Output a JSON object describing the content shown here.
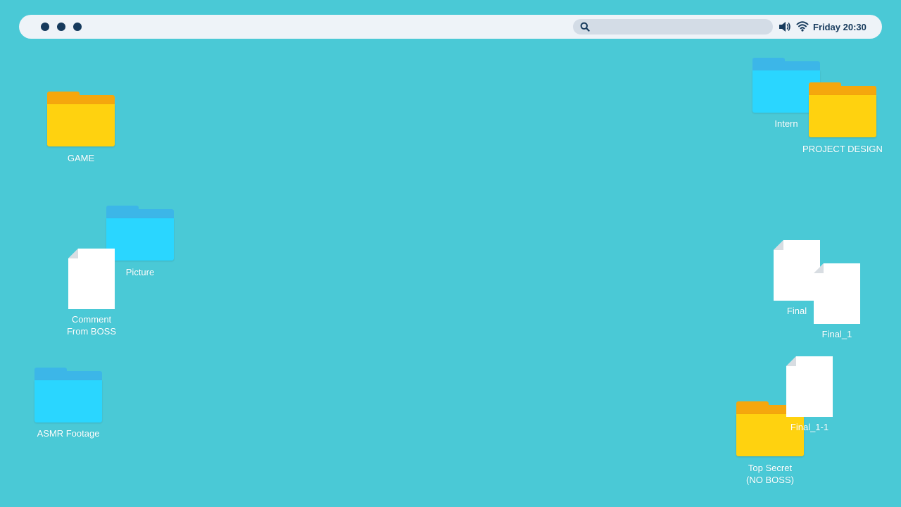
{
  "colors": {
    "desktop_bg": "#4ac9d6",
    "topbar_bg": "#eef3f8",
    "topbar_text": "#163a5c",
    "folder_yellow": "#ffd20f",
    "folder_yellow_tab": "#f5a70d",
    "folder_blue": "#2ad6ff",
    "folder_blue_tab": "#3cb6e8",
    "document": "#ffffff"
  },
  "topbar": {
    "window_dots": [
      "dot",
      "dot",
      "dot"
    ],
    "search": {
      "icon": "search-icon",
      "value": "",
      "placeholder": ""
    },
    "volume_icon": "speaker-icon",
    "wifi_icon": "wifi-icon",
    "clock": "Friday 20:30"
  },
  "desktop": {
    "items": [
      {
        "type": "folder",
        "color": "yellow",
        "label": "GAME"
      },
      {
        "type": "folder",
        "color": "blue",
        "label": "Picture"
      },
      {
        "type": "document",
        "label": "Comment\nFrom BOSS"
      },
      {
        "type": "folder",
        "color": "blue",
        "label": "ASMR Footage"
      },
      {
        "type": "folder",
        "color": "blue",
        "label": "Intern"
      },
      {
        "type": "folder",
        "color": "yellow",
        "label": "PROJECT DESIGN"
      },
      {
        "type": "document",
        "label": "Final"
      },
      {
        "type": "document",
        "label": "Final_1"
      },
      {
        "type": "document",
        "label": "Final_1-1"
      },
      {
        "type": "folder",
        "color": "yellow",
        "label": "Top Secret\n(NO BOSS)"
      }
    ]
  }
}
